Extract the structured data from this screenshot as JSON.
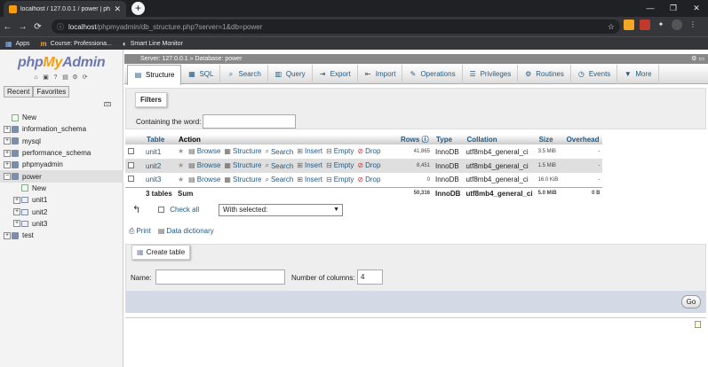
{
  "browser": {
    "tab_title": "localhost / 127.0.0.1 / power | php",
    "tab_close": "✕",
    "new_tab": "+",
    "window_controls": [
      "—",
      "❐",
      "✕"
    ],
    "nav": {
      "back": "←",
      "forward": "→",
      "reload": "⟳"
    },
    "url_host": "localhost",
    "url_path": "/phpmyadmin/db_structure.php?server=1&db=power",
    "bookmarks": [
      {
        "label": "Apps",
        "icon": "apps-grid-icon"
      },
      {
        "label": "Course: Professiona...",
        "icon": "course-icon"
      },
      {
        "label": "Smart Line Monitor",
        "icon": "monitor-icon"
      }
    ]
  },
  "logo": {
    "php": "php",
    "my": "My",
    "admin": "Admin"
  },
  "nav_tabs": [
    "Recent",
    "Favorites"
  ],
  "tree": [
    {
      "label": "New",
      "type": "new",
      "indent": 0,
      "expander": ""
    },
    {
      "label": "information_schema",
      "type": "db",
      "indent": 0,
      "expander": "+"
    },
    {
      "label": "mysql",
      "type": "db",
      "indent": 0,
      "expander": "+"
    },
    {
      "label": "performance_schema",
      "type": "db",
      "indent": 0,
      "expander": "+"
    },
    {
      "label": "phpmyadmin",
      "type": "db",
      "indent": 0,
      "expander": "+"
    },
    {
      "label": "power",
      "type": "db",
      "indent": 0,
      "expander": "−",
      "selected": true
    },
    {
      "label": "New",
      "type": "new",
      "indent": 1,
      "expander": ""
    },
    {
      "label": "unit1",
      "type": "table",
      "indent": 1,
      "expander": "+"
    },
    {
      "label": "unit2",
      "type": "table",
      "indent": 1,
      "expander": "+"
    },
    {
      "label": "unit3",
      "type": "table",
      "indent": 1,
      "expander": "+"
    },
    {
      "label": "test",
      "type": "db",
      "indent": 0,
      "expander": "+"
    }
  ],
  "breadcrumb": "Server: 127.0.0.1 » Database: power",
  "menu": [
    {
      "label": "Structure",
      "icon": "structure-icon",
      "glyph": "▤",
      "active": true
    },
    {
      "label": "SQL",
      "icon": "sql-icon",
      "glyph": "▦"
    },
    {
      "label": "Search",
      "icon": "search-icon",
      "glyph": "⌕"
    },
    {
      "label": "Query",
      "icon": "query-icon",
      "glyph": "▥"
    },
    {
      "label": "Export",
      "icon": "export-icon",
      "glyph": "⇥"
    },
    {
      "label": "Import",
      "icon": "import-icon",
      "glyph": "⇤"
    },
    {
      "label": "Operations",
      "icon": "wrench-icon",
      "glyph": "✎"
    },
    {
      "label": "Privileges",
      "icon": "privileges-icon",
      "glyph": "☰"
    },
    {
      "label": "Routines",
      "icon": "routines-icon",
      "glyph": "⚙"
    },
    {
      "label": "Events",
      "icon": "events-icon",
      "glyph": "◷"
    },
    {
      "label": "More",
      "icon": "chevron-down-icon",
      "glyph": "▼"
    }
  ],
  "filters": {
    "legend": "Filters",
    "label": "Containing the word:",
    "value": ""
  },
  "table": {
    "headers": {
      "table": "Table",
      "action": "Action",
      "rows": "Rows",
      "type": "Type",
      "collation": "Collation",
      "size": "Size",
      "overhead": "Overhead"
    },
    "actions": [
      "Browse",
      "Structure",
      "Search",
      "Insert",
      "Empty",
      "Drop"
    ],
    "rows": [
      {
        "name": "unit1",
        "rows": "41,865",
        "type": "InnoDB",
        "collation": "utf8mb4_general_ci",
        "size": "3.5 MiB",
        "overhead": "-"
      },
      {
        "name": "unit2",
        "rows": "8,451",
        "type": "InnoDB",
        "collation": "utf8mb4_general_ci",
        "size": "1.5 MiB",
        "overhead": "-"
      },
      {
        "name": "unit3",
        "rows": "0",
        "type": "InnoDB",
        "collation": "utf8mb4_general_ci",
        "size": "16.0 KiB",
        "overhead": "-"
      }
    ],
    "footer": {
      "tables": "3 tables",
      "sum": "Sum",
      "rows": "50,316",
      "type": "InnoDB",
      "collation": "utf8mb4_general_ci",
      "size": "5.0 MiB",
      "overhead": "0 B"
    }
  },
  "check_all": "Check all",
  "with_selected": "With selected:",
  "print": "Print",
  "data_dictionary": "Data dictionary",
  "create_table": {
    "legend": "Create table",
    "name_label": "Name:",
    "columns_label": "Number of columns:",
    "columns_value": "4",
    "go": "Go"
  }
}
